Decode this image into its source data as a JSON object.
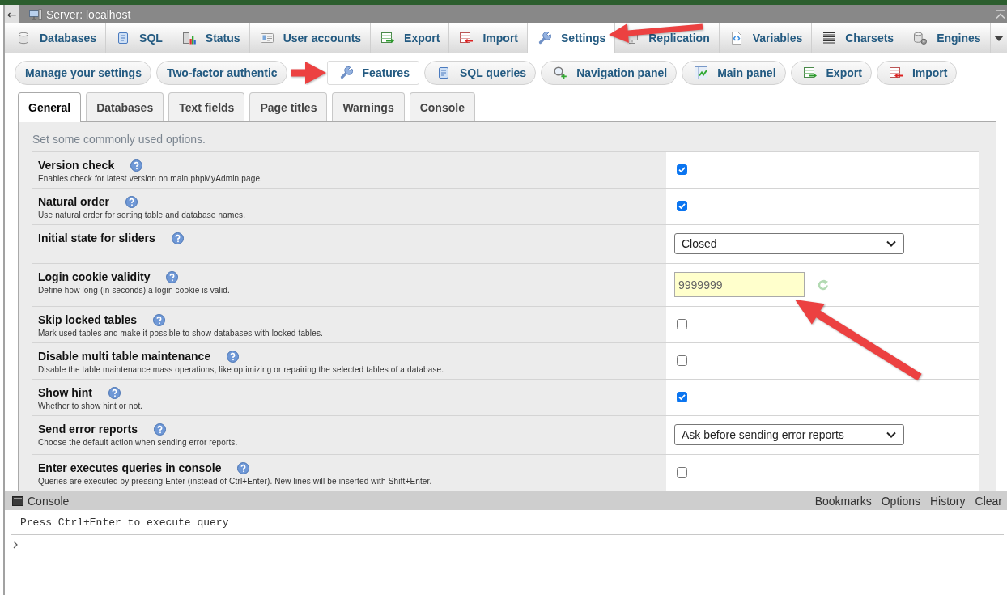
{
  "top_bar": {
    "collapse_button": "←",
    "title": "Server: localhost"
  },
  "menu_tabs": [
    {
      "label": "Databases",
      "selected": false
    },
    {
      "label": "SQL",
      "selected": false
    },
    {
      "label": "Status",
      "selected": false
    },
    {
      "label": "User accounts",
      "selected": false
    },
    {
      "label": "Export",
      "selected": false
    },
    {
      "label": "Import",
      "selected": false
    },
    {
      "label": "Settings",
      "selected": true
    },
    {
      "label": "Replication",
      "selected": false
    },
    {
      "label": "Variables",
      "selected": false
    },
    {
      "label": "Charsets",
      "selected": false
    },
    {
      "label": "Engines",
      "selected": false
    }
  ],
  "settings_tabs": [
    {
      "label": "Manage your settings",
      "selected": false
    },
    {
      "label": "Two-factor authentic",
      "selected": false
    },
    {
      "label": "Features",
      "selected": true
    },
    {
      "label": "SQL queries",
      "selected": false
    },
    {
      "label": "Navigation panel",
      "selected": false
    },
    {
      "label": "Main panel",
      "selected": false
    },
    {
      "label": "Export",
      "selected": false
    },
    {
      "label": "Import",
      "selected": false
    }
  ],
  "form_tabs": [
    {
      "label": "General",
      "selected": true
    },
    {
      "label": "Databases",
      "selected": false
    },
    {
      "label": "Text fields",
      "selected": false
    },
    {
      "label": "Page titles",
      "selected": false
    },
    {
      "label": "Warnings",
      "selected": false
    },
    {
      "label": "Console",
      "selected": false
    }
  ],
  "form": {
    "intro": "Set some commonly used options.",
    "rows": [
      {
        "name": "Version check",
        "description": "Enables check for latest version on main phpMyAdmin page.",
        "kind": "checkbox",
        "checked": true,
        "custom": false
      },
      {
        "name": "Natural order",
        "description": "Use natural order for sorting table and database names.",
        "kind": "checkbox",
        "checked": true,
        "custom": false
      },
      {
        "name": "Initial state for sliders",
        "kind": "select",
        "value": "Closed",
        "custom": false
      },
      {
        "name": "Login cookie validity",
        "description": "Define how long (in seconds) a login cookie is valid.",
        "kind": "text",
        "value": "9999999",
        "custom": true
      },
      {
        "name": "Skip locked tables",
        "description": "Mark used tables and make it possible to show databases with locked tables.",
        "kind": "checkbox",
        "checked": false,
        "custom": false
      },
      {
        "name": "Disable multi table maintenance",
        "description": "Disable the table maintenance mass operations, like optimizing or repairing the selected tables of a database.",
        "kind": "checkbox",
        "checked": false,
        "custom": false
      },
      {
        "name": "Show hint",
        "description": "Whether to show hint or not.",
        "kind": "checkbox",
        "checked": true,
        "custom": false
      },
      {
        "name": "Send error reports",
        "description": "Choose the default action when sending error reports.",
        "kind": "select",
        "value": "Ask before sending error reports",
        "custom": false
      },
      {
        "name": "Enter executes queries in console",
        "description": "Queries are executed by pressing Enter (instead of Ctrl+Enter). New lines will be inserted with Shift+Enter.",
        "kind": "checkbox",
        "checked": false,
        "custom": false
      }
    ]
  },
  "console": {
    "title": "Console",
    "actions": [
      "Bookmarks",
      "Options",
      "History",
      "Clear"
    ],
    "hint": "Press Ctrl+Enter to execute query"
  }
}
